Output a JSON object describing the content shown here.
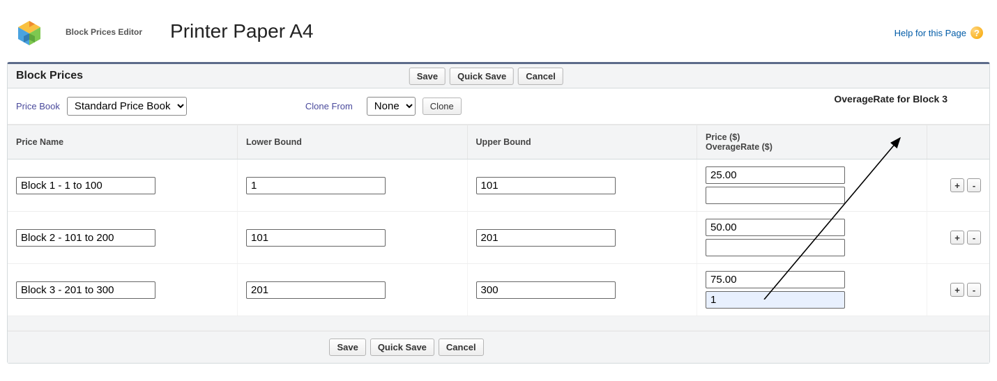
{
  "header": {
    "editor_label": "Block Prices Editor",
    "product_title": "Printer Paper A4",
    "help_text": "Help for this Page"
  },
  "panel": {
    "title": "Block Prices",
    "buttons": {
      "save": "Save",
      "quick_save": "Quick Save",
      "cancel": "Cancel"
    }
  },
  "controls": {
    "price_book_label": "Price Book",
    "price_book_value": "Standard Price Book",
    "clone_from_label": "Clone From",
    "clone_from_value": "None",
    "clone_button": "Clone"
  },
  "annotation": {
    "text": "OverageRate for Block 3"
  },
  "table": {
    "headers": {
      "price_name": "Price Name",
      "lower_bound": "Lower Bound",
      "upper_bound": "Upper Bound",
      "price_line1": "Price ($)",
      "price_line2": "OverageRate ($)"
    },
    "rows": [
      {
        "price_name": "Block 1 - 1 to 100",
        "lower": "1",
        "upper": "101",
        "price": "25.00",
        "overage": ""
      },
      {
        "price_name": "Block 2 - 101 to 200",
        "lower": "101",
        "upper": "201",
        "price": "50.00",
        "overage": ""
      },
      {
        "price_name": "Block 3 - 201 to 300",
        "lower": "201",
        "upper": "300",
        "price": "75.00",
        "overage": "1"
      }
    ]
  }
}
